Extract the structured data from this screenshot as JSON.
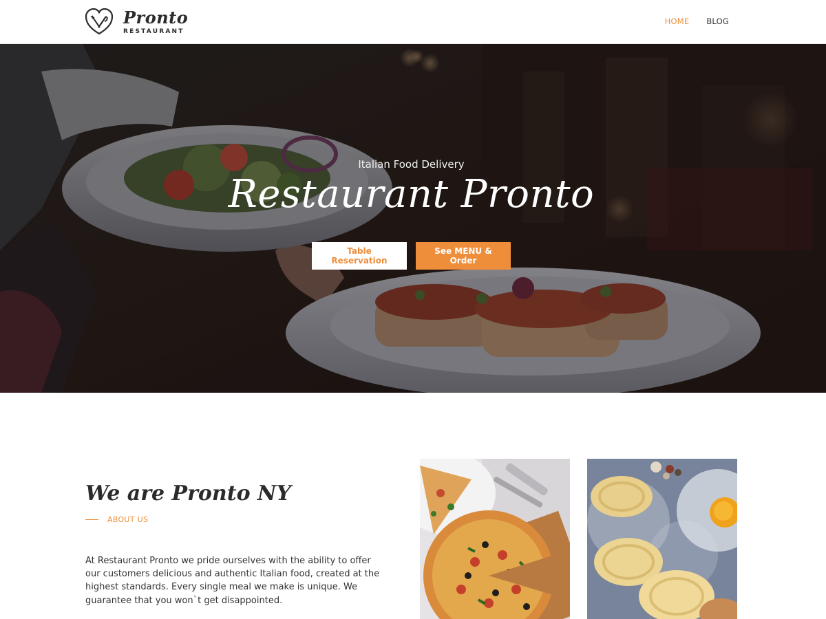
{
  "header": {
    "logo": {
      "name": "Pronto",
      "subtitle": "RESTAURANT"
    },
    "nav": [
      {
        "label": "HOME",
        "active": true
      },
      {
        "label": "BLOG",
        "active": false
      }
    ]
  },
  "hero": {
    "subtitle": "Italian Food Delivery",
    "title": "Restaurant Pronto",
    "buttons": {
      "reservation": "Table Reservation",
      "menu": "See MENU & Order"
    }
  },
  "about": {
    "title": "We are Pronto NY",
    "label": "ABOUT US",
    "body": "At Restaurant Pronto we pride ourselves with the ability to offer our customers delicious and authentic Italian food, created at the highest standards. Every single meal we make is unique. We guarantee that you won`t get disappointed."
  },
  "colors": {
    "accent": "#ee8e3b",
    "text": "#333333",
    "hero_overlay": "#1c1614"
  },
  "icons": {
    "logo": "fork-knife-heart-icon"
  }
}
